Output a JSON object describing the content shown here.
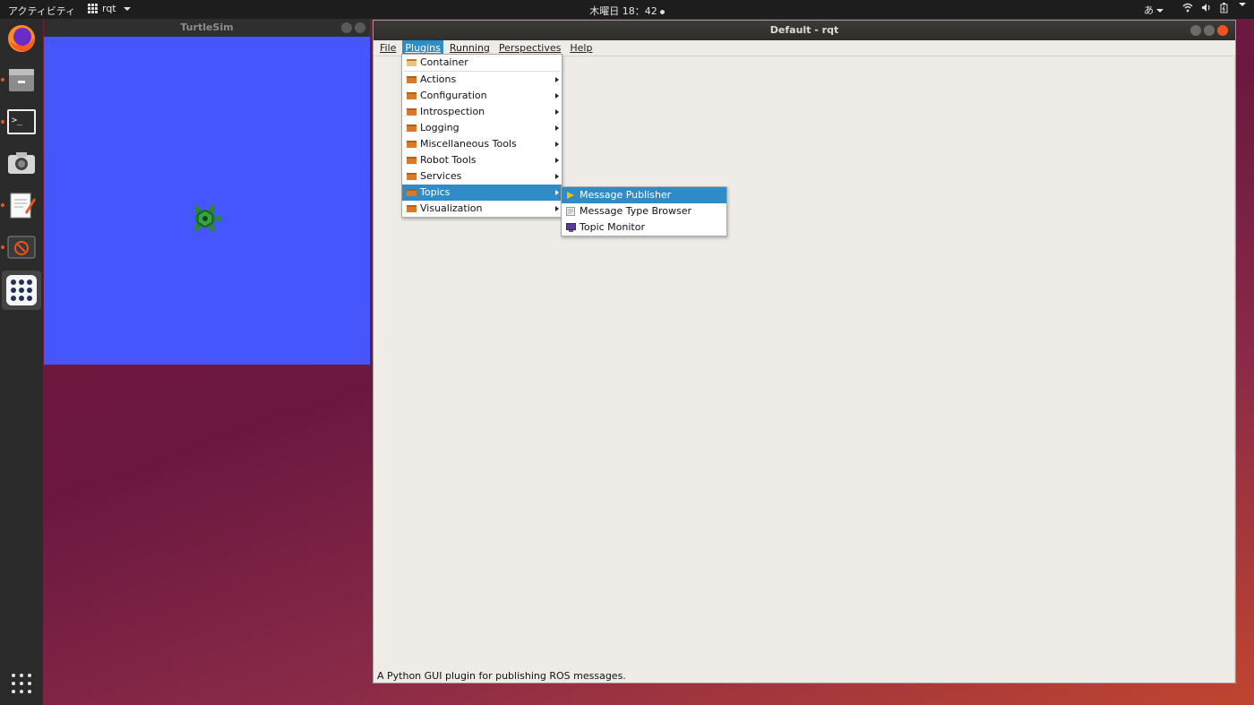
{
  "topbar": {
    "activities": "アクティビティ",
    "app_name": "rqt",
    "clock": "木曜日 18：42",
    "ime": "あ"
  },
  "dock": {
    "items": [
      "firefox-icon",
      "files-icon",
      "terminal-icon",
      "screenshot-icon",
      "text-editor-icon",
      "system-monitor-icon",
      "app-grid-icon"
    ],
    "show_apps": "show-apps-icon"
  },
  "turtlesim": {
    "title": "TurtleSim",
    "background": "#4556ff"
  },
  "rqt": {
    "title": "Default - rqt",
    "menubar": [
      "File",
      "Plugins",
      "Running",
      "Perspectives",
      "Help"
    ],
    "status": "A Python GUI plugin for publishing ROS messages."
  },
  "plugins_menu": {
    "items": [
      {
        "label": "Container"
      },
      {
        "label": "Actions"
      },
      {
        "label": "Configuration"
      },
      {
        "label": "Introspection"
      },
      {
        "label": "Logging"
      },
      {
        "label": "Miscellaneous Tools"
      },
      {
        "label": "Robot Tools"
      },
      {
        "label": "Services"
      },
      {
        "label": "Topics"
      },
      {
        "label": "Visualization"
      }
    ]
  },
  "topics_menu": {
    "items": [
      {
        "label": "Message Publisher"
      },
      {
        "label": "Message Type Browser"
      },
      {
        "label": "Topic Monitor"
      }
    ]
  },
  "colors": {
    "accent": "#308cc6",
    "ubuntu_orange": "#e95420"
  }
}
